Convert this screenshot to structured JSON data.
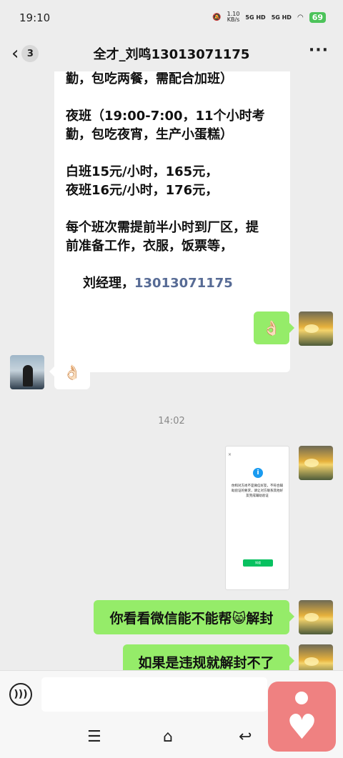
{
  "status_bar": {
    "time": "19:10",
    "speed_value": "1.10",
    "speed_unit": "KB/s",
    "signal1": "5G HD",
    "signal2": "5G HD",
    "battery": "69"
  },
  "nav": {
    "unread_count": "3",
    "title": "全才_刘鸣13013071175",
    "more": "···"
  },
  "messages": {
    "long_text": {
      "p1": "勤，包吃两餐，需配合加班）",
      "p2": "夜班（19:00-7:00，11个小时考\n勤，包吃夜宵，生产小蛋糕）",
      "p3": "白班15元/小时，165元，\n夜班16元/小时，176元，",
      "p4": "每个班次需提前半小时到厂区，提\n前准备工作，衣服，饭票等，",
      "signature": "刘经理，",
      "phone": "13013071175"
    },
    "self_emoji": "👌🏻",
    "other_emoji": "👌🏻",
    "time_divider": "14:02",
    "screenshot": {
      "close": "×",
      "info": "i",
      "body": "你和对方尚不是微信好友，不符合辅助验证的要求，请让对方联系其他好友完成辅助验证",
      "button": "知道"
    },
    "msg1": "你看看微信能不能帮😸解封",
    "msg2": "如果是违规就解封不了"
  },
  "bottom_bar": {
    "voice_icon": "voice-icon",
    "menu_glyph": "☰",
    "home_glyph": "⌂",
    "back_glyph": "↩"
  }
}
